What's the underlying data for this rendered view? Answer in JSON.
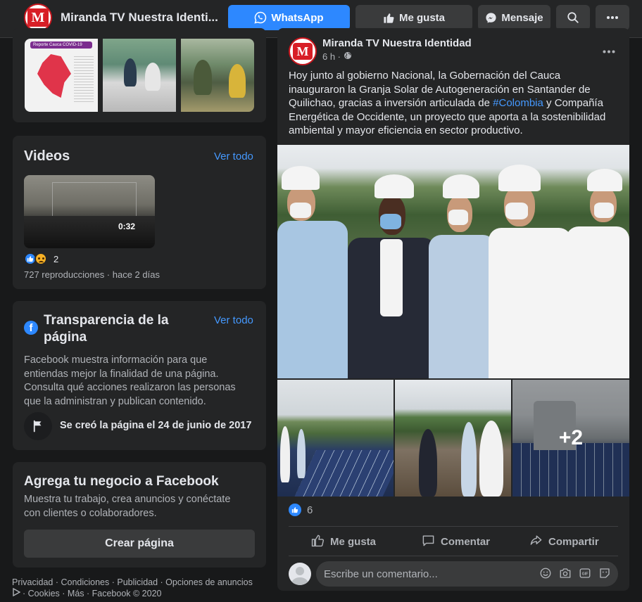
{
  "topbar": {
    "page_name": "Miranda TV Nuestra Identi...",
    "whatsapp_label": "WhatsApp",
    "like_label": "Me gusta",
    "message_label": "Mensaje",
    "logo_letter": "M"
  },
  "photos": {
    "thumb1_header": "Reporte Cauca COVID-19"
  },
  "videos": {
    "title": "Videos",
    "see_all": "Ver todo",
    "duration": "0:32",
    "reaction_count": "2",
    "meta": "727 reproducciones · hace 2 días"
  },
  "transparency": {
    "title_line1": "Transparencia de la",
    "title_line2": "página",
    "see_all": "Ver todo",
    "fb_letter": "f",
    "body": "Facebook muestra información para que entiendas mejor la finalidad de una página. Consulta qué acciones realizaron las personas que la administran y publican contenido.",
    "created": "Se creó la página el 24 de junio de 2017"
  },
  "business": {
    "title": "Agrega tu negocio a Facebook",
    "body": "Muestra tu trabajo, crea anuncios y conéctate con clientes o colaboradores.",
    "button": "Crear página"
  },
  "footer": {
    "line1": "Privacidad · Condiciones · Publicidad · Opciones de anuncios",
    "line2": "· Cookies · Más · Facebook © 2020"
  },
  "post": {
    "author": "Miranda TV Nuestra Identidad",
    "time": "6 h ·",
    "text_before": "Hoy junto al gobierno Nacional, la Gobernación del Cauca inauguraron la Granja Solar de Autogeneración en Santander de Quilichao, gracias a inversión articulada de ",
    "hashtag": "#Colombia",
    "text_after": " y Compañía Energética de Occidente, un proyecto que aporta a la sostenibilidad ambiental y mayor eficiencia en sector productivo.",
    "more_photos": "+2",
    "likes": "6",
    "like_action": "Me gusta",
    "comment_action": "Comentar",
    "share_action": "Compartir",
    "comment_placeholder": "Escribe un comentario..."
  },
  "colors": {
    "background": "#18191a",
    "card": "#242526",
    "accent": "#2d88ff",
    "link": "#4599ff",
    "brand_red": "#d81e26"
  },
  "icons": [
    "whatsapp-icon",
    "thumbs-up-icon",
    "messenger-icon",
    "search-icon",
    "more-icon",
    "globe-icon",
    "facebook-icon",
    "flag-icon",
    "comment-icon",
    "share-icon",
    "emoji-icon",
    "camera-icon",
    "gif-icon",
    "sticker-icon"
  ]
}
